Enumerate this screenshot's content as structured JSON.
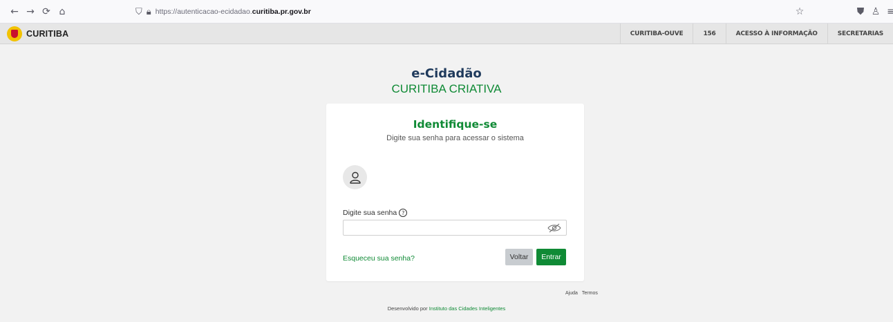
{
  "browser": {
    "url_prefix": "https://autenticacao-ecidadao.",
    "url_domain": "curitiba.pr.gov.br"
  },
  "header": {
    "brand": "CURITIBA",
    "links": [
      "CURITIBA-OUVE",
      "156",
      "ACESSO À INFORMAÇÃO",
      "SECRETARIAS"
    ]
  },
  "app": {
    "title": "e-Cidadão",
    "subtitle": "CURITIBA CRIATIVA"
  },
  "login": {
    "heading": "Identifique-se",
    "instructions": "Digite sua senha para acessar o sistema",
    "password_label": "Digite sua senha",
    "password_value": "",
    "forgot_label": "Esqueceu sua senha?",
    "back_label": "Voltar",
    "submit_label": "Entrar"
  },
  "footer": {
    "help": "Ajuda",
    "terms": "Termos",
    "developed_by": "Desenvolvido por",
    "developer": "Instituto das Cidades Inteligentes"
  },
  "colors": {
    "brand_green": "#0f8a35",
    "title_navy": "#1f3a5c",
    "page_background": "#f2f2f2"
  }
}
